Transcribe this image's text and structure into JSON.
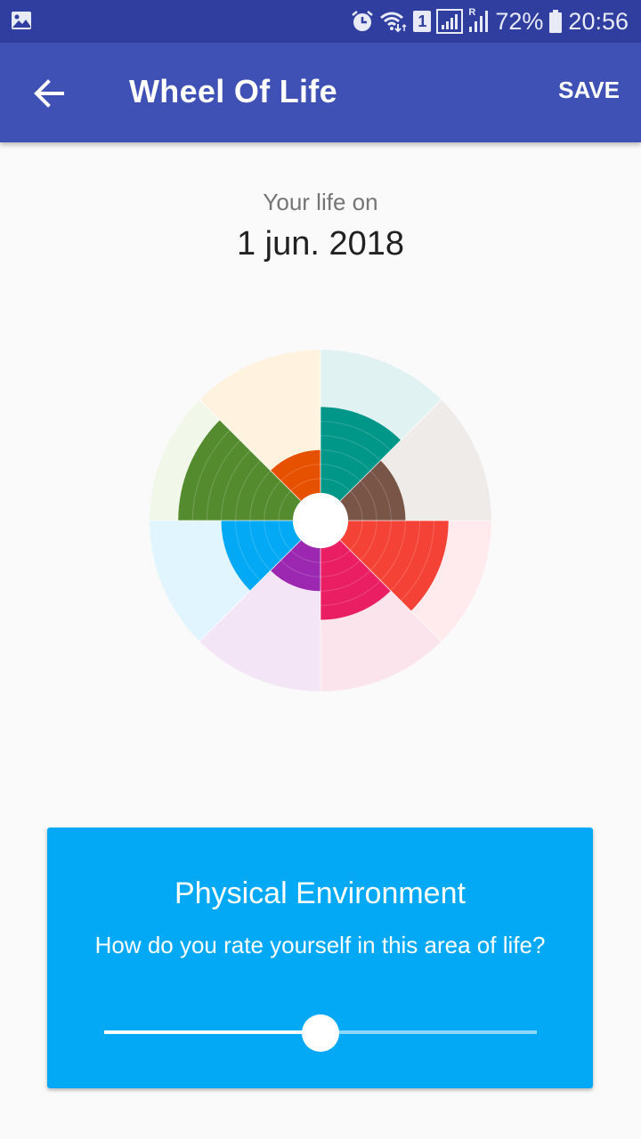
{
  "status_bar": {
    "left_icon": "image-icon",
    "icons": [
      "alarm-icon",
      "wifi-icon",
      "sim-1-icon",
      "signal-icon",
      "roaming-signal-icon",
      "battery-icon"
    ],
    "sim_label": "1",
    "roaming_label": "R",
    "battery": "72%",
    "time": "20:56"
  },
  "app_bar": {
    "back_icon": "arrow-back-icon",
    "title": "Wheel Of Life",
    "save_label": "SAVE"
  },
  "header": {
    "subtitle": "Your life on",
    "date": "1 jun. 2018"
  },
  "colors": {
    "status_bar": "#303F9F",
    "app_bar": "#3F51B5",
    "background": "#FAFAFA",
    "card": "#03A9F4"
  },
  "chart_data": {
    "type": "polar-area",
    "scale_max": 10,
    "rings": 10,
    "segments": [
      {
        "value": 6,
        "color": "#009688",
        "bg": "#E0F2F1"
      },
      {
        "value": 4,
        "color": "#795548",
        "bg": "#EFEBE9"
      },
      {
        "value": 7,
        "color": "#F44336",
        "bg": "#FFEBEE"
      },
      {
        "value": 5,
        "color": "#E91E63",
        "bg": "#FCE4EC"
      },
      {
        "value": 3,
        "color": "#9C27B0",
        "bg": "#F3E5F5"
      },
      {
        "value": 5,
        "color": "#03A9F4",
        "bg": "#E1F5FE"
      },
      {
        "value": 8,
        "color": "#558B2F",
        "bg": "#F1F8E9"
      },
      {
        "value": 3,
        "color": "#E65100",
        "bg": "#FFF3E0"
      }
    ]
  },
  "card": {
    "title": "Physical Environment",
    "question": "How do you rate yourself in this area of life?",
    "slider_value": 5,
    "slider_max": 10
  }
}
